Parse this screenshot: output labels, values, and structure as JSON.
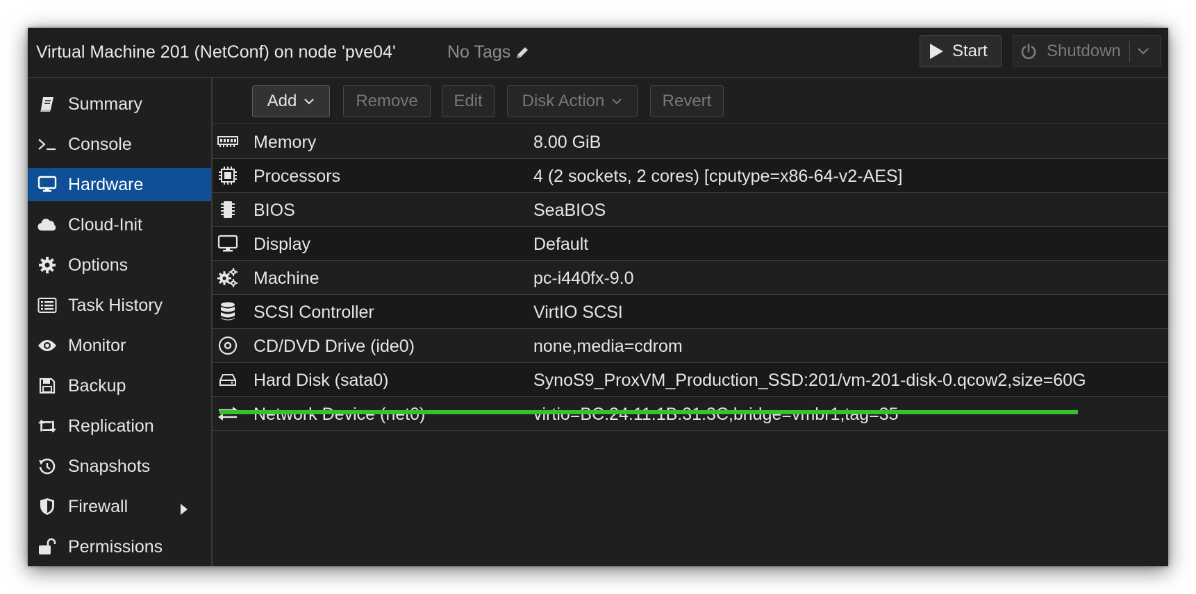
{
  "header": {
    "title": "Virtual Machine 201 (NetConf) on node 'pve04'",
    "tags_label": "No Tags",
    "start_label": "Start",
    "shutdown_label": "Shutdown"
  },
  "sidebar": {
    "items": [
      {
        "label": "Summary",
        "icon": "book-icon"
      },
      {
        "label": "Console",
        "icon": "terminal-icon"
      },
      {
        "label": "Hardware",
        "icon": "desktop-icon",
        "active": true
      },
      {
        "label": "Cloud-Init",
        "icon": "cloud-icon"
      },
      {
        "label": "Options",
        "icon": "gear-icon"
      },
      {
        "label": "Task History",
        "icon": "list-icon"
      },
      {
        "label": "Monitor",
        "icon": "eye-icon"
      },
      {
        "label": "Backup",
        "icon": "floppy-icon"
      },
      {
        "label": "Replication",
        "icon": "retweet-icon"
      },
      {
        "label": "Snapshots",
        "icon": "history-icon"
      },
      {
        "label": "Firewall",
        "icon": "shield-icon"
      },
      {
        "label": "Permissions",
        "icon": "unlock-icon"
      }
    ]
  },
  "toolbar": {
    "add_label": "Add",
    "remove_label": "Remove",
    "edit_label": "Edit",
    "disk_action_label": "Disk Action",
    "revert_label": "Revert"
  },
  "hardware": [
    {
      "name": "Memory",
      "value": "8.00 GiB",
      "icon": "memory-icon"
    },
    {
      "name": "Processors",
      "value": "4 (2 sockets, 2 cores) [cputype=x86-64-v2-AES]",
      "icon": "cpu-icon"
    },
    {
      "name": "BIOS",
      "value": "SeaBIOS",
      "icon": "microchip-icon"
    },
    {
      "name": "Display",
      "value": "Default",
      "icon": "desktop-icon"
    },
    {
      "name": "Machine",
      "value": "pc-i440fx-9.0",
      "icon": "cogs-icon"
    },
    {
      "name": "SCSI Controller",
      "value": "VirtIO SCSI",
      "icon": "database-icon"
    },
    {
      "name": "CD/DVD Drive (ide0)",
      "value": "none,media=cdrom",
      "icon": "disc-icon"
    },
    {
      "name": "Hard Disk (sata0)",
      "value": "SynoS9_ProxVM_Production_SSD:201/vm-201-disk-0.qcow2,size=60G",
      "icon": "hdd-icon"
    },
    {
      "name": "Network Device (net0)",
      "value": "virtio=BC:24:11:1B:31:3C,bridge=vmbr1,tag=35",
      "icon": "exchange-icon"
    }
  ],
  "colors": {
    "active_nav": "#0e4f96",
    "highlight_underline": "#36c22e"
  }
}
